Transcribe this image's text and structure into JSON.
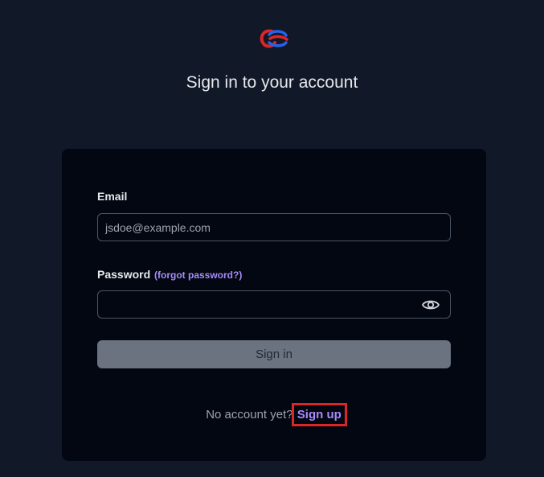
{
  "header": {
    "logo_icon": "knot-logo-icon",
    "title": "Sign in to your account"
  },
  "form": {
    "email": {
      "label": "Email",
      "placeholder": "jsdoe@example.com",
      "value": ""
    },
    "password": {
      "label": "Password",
      "forgot_link": "(forgot password?)",
      "value": "",
      "toggle_icon": "eye-icon"
    },
    "submit_label": "Sign in"
  },
  "footer": {
    "prompt": "No account yet?",
    "signup_link": "Sign up"
  },
  "colors": {
    "background": "#111827",
    "card": "#030712",
    "accent": "#a78bfa",
    "button": "#6b7280",
    "highlight": "#dc2626"
  }
}
